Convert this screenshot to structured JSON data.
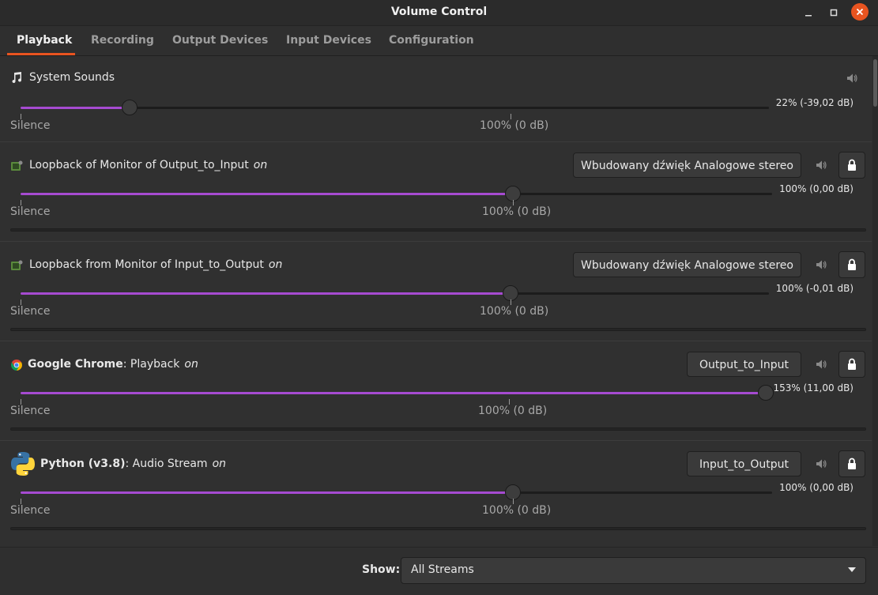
{
  "window": {
    "title": "Volume Control"
  },
  "tabs": [
    {
      "label": "Playback"
    },
    {
      "label": "Recording"
    },
    {
      "label": "Output Devices"
    },
    {
      "label": "Input Devices"
    },
    {
      "label": "Configuration"
    }
  ],
  "scale": {
    "left_label": "Silence",
    "mid_label": "100% (0 dB)"
  },
  "streams": [
    {
      "name": "System Sounds",
      "bold_name": "",
      "suffix": "",
      "status": "",
      "device": "",
      "volume_text": "22% (-39,02 dB)",
      "volume_percent": 22,
      "icon": "music-note-icon"
    },
    {
      "name": "Loopback of Monitor of Output_to_Input",
      "bold_name": "",
      "suffix": "",
      "status": "on",
      "device": "Wbudowany dźwięk Analogowe stereo",
      "volume_text": "100% (0,00 dB)",
      "volume_percent": 100,
      "icon": "loopback-icon"
    },
    {
      "name": "Loopback from Monitor of Input_to_Output",
      "bold_name": "",
      "suffix": "",
      "status": "on",
      "device": "Wbudowany dźwięk Analogowe stereo",
      "volume_text": "100% (-0,01 dB)",
      "volume_percent": 100,
      "icon": "loopback-icon"
    },
    {
      "name": "",
      "bold_name": "Google Chrome",
      "suffix": ": Playback",
      "status": "on",
      "device": "Output_to_Input",
      "volume_text": "153% (11,00 dB)",
      "volume_percent": 153,
      "icon": "chrome-icon"
    },
    {
      "name": "",
      "bold_name": "Python (v3.8)",
      "suffix": ": Audio Stream",
      "status": "on",
      "device": "Input_to_Output",
      "volume_text": "100% (0,00 dB)",
      "volume_percent": 100,
      "icon": "python-icon"
    }
  ],
  "footer": {
    "show_label": "Show:",
    "show_value": "All Streams"
  },
  "colors": {
    "accent": "#e95420",
    "slider_fill": "#a64bd1",
    "background": "#303030"
  }
}
